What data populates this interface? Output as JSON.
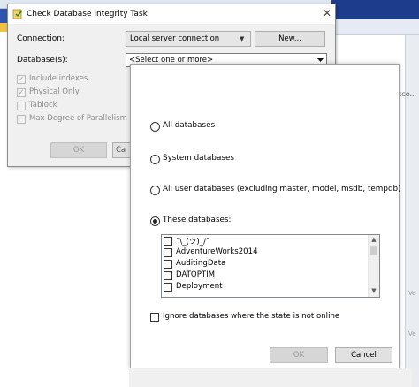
{
  "dialog": {
    "title": "Check Database Integrity Task",
    "close_glyph": "✕",
    "connection_label": "Connection:",
    "connection_value": "Local server connection",
    "new_button": "New...",
    "databases_label": "Database(s):",
    "databases_value": "<Select one or more>",
    "options": [
      {
        "label": "Include indexes",
        "checked": true
      },
      {
        "label": "Physical Only",
        "checked": true
      },
      {
        "label": "Tablock",
        "checked": false
      },
      {
        "label": "Max Degree of Parallelism",
        "checked": false
      }
    ],
    "ok_button": "OK",
    "cancel_button": "Ca"
  },
  "popup": {
    "radios": [
      {
        "label": "All databases",
        "selected": false
      },
      {
        "label": "System databases",
        "selected": false
      },
      {
        "label": "All user databases  (excluding master, model, msdb, tempdb)",
        "selected": false
      },
      {
        "label": "These databases:",
        "selected": true
      }
    ],
    "databases": [
      "¯\\_(ツ)_/¯",
      "AdventureWorks2014",
      "AuditingData",
      "DATOPTIM",
      "Deployment"
    ],
    "ignore_label": "Ignore databases where the state is not online",
    "ok_button": "OK",
    "cancel_button": "Cancel"
  },
  "background": {
    "fragment_1": "acco...",
    "fragment_2": "Ve",
    "fragment_3": "Ve"
  }
}
